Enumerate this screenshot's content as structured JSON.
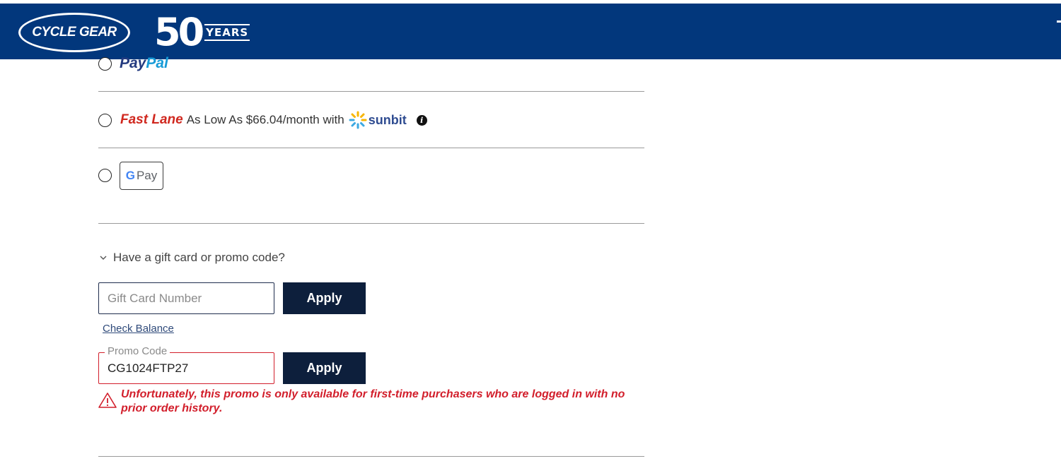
{
  "header": {
    "logo_text": "CYCLE GEAR",
    "badge_number": "50",
    "badge_label": "YEARS",
    "bg_color": "#02377c"
  },
  "payment_options": {
    "paypal": {
      "part1": "Pay",
      "part2": "Pal"
    },
    "fastlane": {
      "brand": "Fast Lane",
      "text": "As Low As $66.04/month with",
      "provider": "sunbit",
      "info_icon": "info-icon"
    },
    "gpay": {
      "g": "G",
      "label": "Pay"
    }
  },
  "promo": {
    "toggle_label": "Have a gift card or promo code?",
    "gift_card": {
      "placeholder": "Gift Card Number",
      "value": "",
      "apply_label": "Apply"
    },
    "check_balance_label": "Check Balance",
    "promo_code": {
      "label": "Promo Code",
      "value": "CG1024FTP27",
      "apply_label": "Apply"
    },
    "error_message": "Unfortunately, this promo is only available for first-time purchasers who are logged in with no prior order history."
  },
  "colors": {
    "primary_blue": "#02377c",
    "button_navy": "#0d1f3c",
    "error_red": "#d21e2b",
    "fastlane_red": "#d0281f"
  }
}
